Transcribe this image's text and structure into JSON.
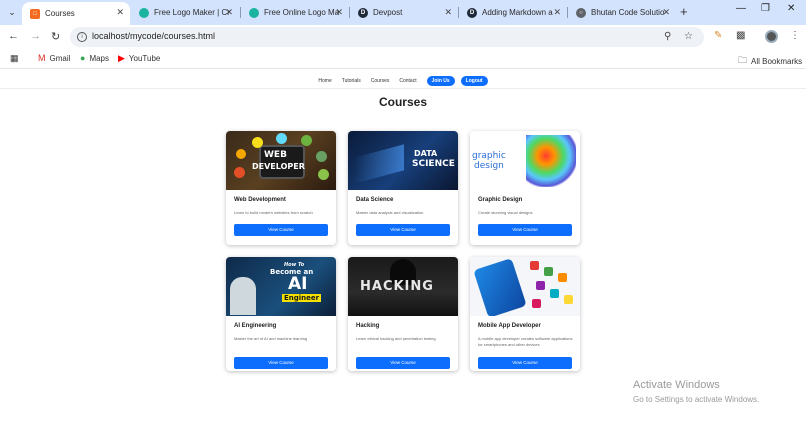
{
  "browser": {
    "tabs": [
      {
        "title": "Courses",
        "active": true,
        "favicon": "orange-square-icon"
      },
      {
        "title": "Free Logo Maker | Cr",
        "active": false,
        "favicon": "teal-circle-icon"
      },
      {
        "title": "Free Online Logo Ma",
        "active": false,
        "favicon": "teal-circle-icon"
      },
      {
        "title": "Devpost",
        "active": false,
        "favicon": "devpost-icon"
      },
      {
        "title": "Adding Markdown a",
        "active": false,
        "favicon": "devpost-icon"
      },
      {
        "title": "Bhutan Code Solutio",
        "active": false,
        "favicon": "globe-icon"
      }
    ],
    "url": "localhost/mycode/courses.html",
    "bookmarks": [
      {
        "label": "Gmail",
        "icon": "gmail-icon"
      },
      {
        "label": "Maps",
        "icon": "maps-icon"
      },
      {
        "label": "YouTube",
        "icon": "youtube-icon"
      }
    ],
    "all_bookmarks": "All Bookmarks"
  },
  "site": {
    "nav": [
      "Home",
      "Tutorials",
      "Courses",
      "Contact"
    ],
    "join_label": "Join Us",
    "login_label": "Logout",
    "heading": "Courses",
    "accent": "#0d6efd"
  },
  "courses": [
    {
      "title": "Web Development",
      "desc": "Learn to build modern websites from scratch",
      "button": "View Course",
      "image_text": [
        "WEB",
        "DEVELOPER"
      ]
    },
    {
      "title": "Data Science",
      "desc": "Master data analysis and visualization",
      "button": "View Course",
      "image_text": [
        "DATA",
        "SCIENCE"
      ]
    },
    {
      "title": "Graphic Design",
      "desc": "Create stunning visual designs",
      "button": "View Course",
      "image_text": [
        "graphic",
        "design"
      ]
    },
    {
      "title": "AI Engineering",
      "desc": "Master the art of AI and machine learning",
      "button": "View Course",
      "image_text": [
        "How To",
        "Become an",
        "AI",
        "Engineer"
      ]
    },
    {
      "title": "Hacking",
      "desc": "Learn ethical hacking and penetration testing",
      "button": "View Course",
      "image_text": [
        "HACKING"
      ]
    },
    {
      "title": "Mobile App Developer",
      "desc": "A mobile app developer creates software applications for smartphones and other devices",
      "button": "View Course",
      "image_text": []
    }
  ],
  "watermark": {
    "title": "Activate Windows",
    "subtitle": "Go to Settings to activate Windows."
  }
}
